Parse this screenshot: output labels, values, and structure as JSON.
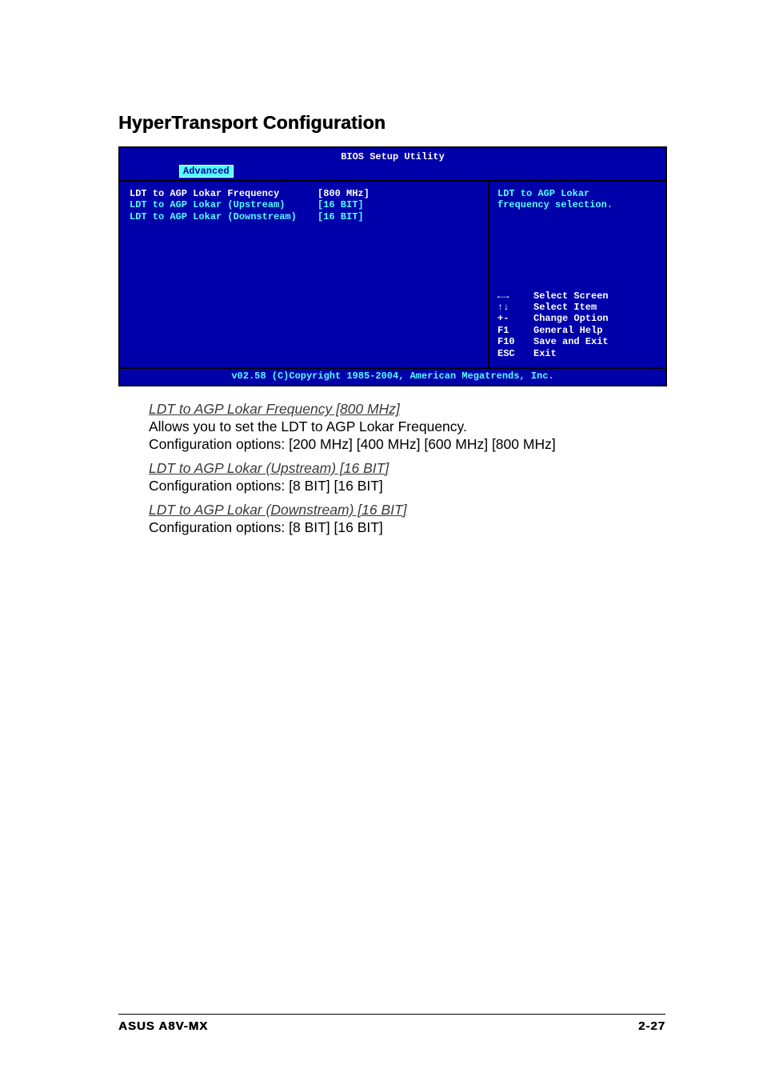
{
  "section_title": "HyperTransport Configuration",
  "bios": {
    "title": "BIOS Setup Utility",
    "tab": "Advanced",
    "items": [
      {
        "label": "LDT to AGP Lokar Frequency",
        "value": "[800 MHz]",
        "selected": true
      },
      {
        "label": "LDT to AGP Lokar (Upstream)",
        "value": "[16 BIT]",
        "selected": false
      },
      {
        "label": "LDT to AGP Lokar (Downstream)",
        "value": "[16 BIT]",
        "selected": false
      }
    ],
    "help_text_line1": "LDT to AGP Lokar",
    "help_text_line2": "frequency selection.",
    "nav": [
      {
        "key": "←→",
        "desc": "Select Screen"
      },
      {
        "key": "↑↓",
        "desc": "Select Item"
      },
      {
        "key": "+-",
        "desc": "Change Option"
      },
      {
        "key": "F1",
        "desc": "General Help"
      },
      {
        "key": "F10",
        "desc": "Save and Exit"
      },
      {
        "key": "ESC",
        "desc": "Exit"
      }
    ],
    "footer": "v02.58 (C)Copyright 1985-2004, American Megatrends, Inc."
  },
  "doc": {
    "items": [
      {
        "head": "LDT to AGP Lokar Frequency [800 MHz]",
        "lines": [
          "Allows you to set the LDT to AGP Lokar Frequency.",
          "Configuration options: [200 MHz] [400 MHz] [600 MHz] [800 MHz]"
        ]
      },
      {
        "head": "LDT to AGP Lokar (Upstream) [16 BIT]",
        "lines": [
          "Configuration options: [8 BIT] [16 BIT]"
        ]
      },
      {
        "head": "LDT to AGP Lokar (Downstream) [16 BIT]",
        "lines": [
          "Configuration options: [8 BIT] [16 BIT]"
        ]
      }
    ]
  },
  "footer_left": "ASUS A8V-MX",
  "footer_right": "2-27"
}
